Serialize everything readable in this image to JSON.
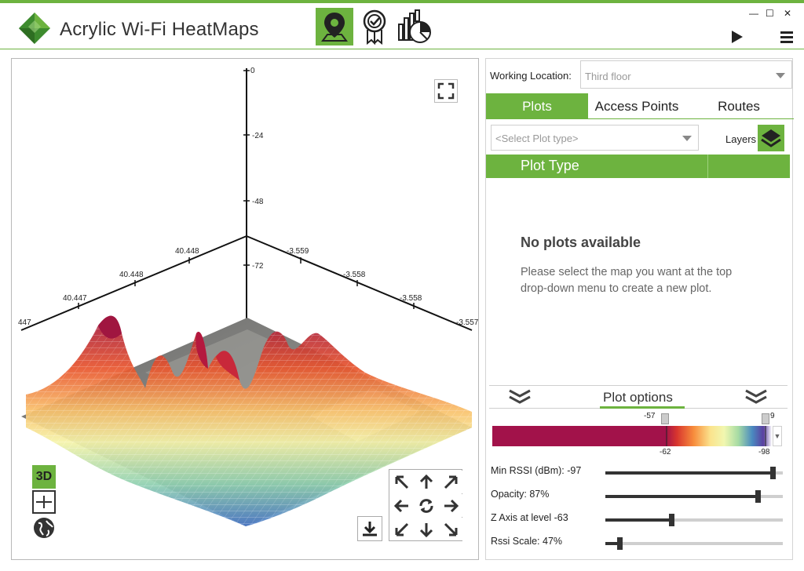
{
  "app": {
    "title": "Acrylic Wi-Fi HeatMaps",
    "nav": [
      {
        "name": "location-pin-icon",
        "active": true
      },
      {
        "name": "certificate-badge-icon",
        "active": false
      },
      {
        "name": "report-chart-icon",
        "active": false
      }
    ],
    "window_controls": {
      "minimize": "—",
      "maximize": "☐",
      "close": "✕"
    }
  },
  "viewport": {
    "axes": {
      "z_ticks": [
        "0",
        "-24",
        "-48",
        "-72"
      ],
      "left_ticks": [
        "40.448",
        "40.448",
        "40.447",
        "447"
      ],
      "right_ticks": [
        "-3.559",
        "-3.558",
        "-3.558",
        "-3.557"
      ]
    },
    "view_buttons": {
      "btn3d": "3D"
    }
  },
  "panel": {
    "working_location": {
      "label": "Working Location:",
      "value": "Third floor"
    },
    "tabs": [
      {
        "label": "Plots",
        "active": true
      },
      {
        "label": "Access Points",
        "active": false
      },
      {
        "label": "Routes",
        "active": false
      }
    ],
    "plot_type_select": {
      "placeholder": "<Select Plot type>"
    },
    "layers_label": "Layers",
    "plot_header": "Plot Type",
    "empty_title": "No plots available",
    "empty_desc": "Please select the map you want at the top drop-down menu to create a new plot.",
    "plot_options": {
      "title": "Plot options",
      "scale_top_left": "-57",
      "scale_top_right": "9",
      "scale_bottom_left": "-62",
      "scale_bottom_right": "-98",
      "sliders": [
        {
          "label": "Min RSSI (dBm): -97",
          "level": 0.96
        },
        {
          "label": "Opacity: 87%",
          "level": 0.87
        },
        {
          "label": "Z Axis at level -63",
          "level": 0.37
        },
        {
          "label": "Rssi Scale: 47%",
          "level": 0.07
        }
      ]
    }
  },
  "colors": {
    "accent": "#6db33f",
    "text": "#222222"
  }
}
